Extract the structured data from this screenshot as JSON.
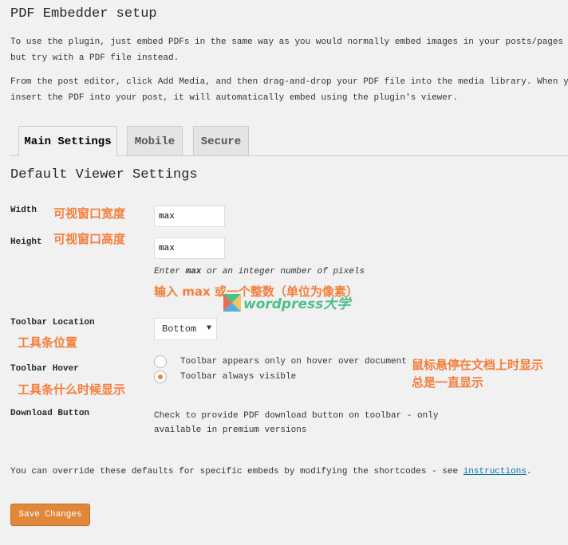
{
  "title": "PDF Embedder setup",
  "intro1a": "To use the plugin, just embed PDFs in the same way as you would normally embed images in your posts/pages -",
  "intro1b": "but try with a PDF file instead.",
  "intro2a": "From the post editor, click Add Media, and then drag-and-drop your PDF file into the media library. When you",
  "intro2b": "insert the PDF into your post, it will automatically embed using the plugin's viewer.",
  "tabs": [
    {
      "label": "Main Settings",
      "active": true
    },
    {
      "label": "Mobile"
    },
    {
      "label": "Secure"
    }
  ],
  "section_title": "Default Viewer Settings",
  "width": {
    "label": "Width",
    "note": "可视窗口宽度",
    "value": "max"
  },
  "height": {
    "label": "Height",
    "note": "可视窗口高度",
    "value": "max"
  },
  "hint_pre": "Enter ",
  "hint_bold": "max",
  "hint_post": " or an integer number of pixels",
  "hint_cn": "输入 max 或一个整数（单位为像素）",
  "watermark": "wordpress大学",
  "toolbar_location": {
    "label": "Toolbar Location",
    "note": "工具条位置",
    "value": "Bottom"
  },
  "toolbar_hover": {
    "label": "Toolbar Hover",
    "note": "工具条什么时候显示",
    "options": [
      "Toolbar appears only on hover over document",
      "Toolbar always visible"
    ],
    "selected": 1,
    "notes": [
      "鼠标悬停在文档上时显示",
      "总是一直显示"
    ]
  },
  "download": {
    "label": "Download Button",
    "text1": "Check to provide PDF download button on toolbar - only",
    "text2": "available in premium versions"
  },
  "footer_pre": "You can override these defaults for specific embeds by modifying the shortcodes - see ",
  "footer_link": "instructions",
  "footer_post": ".",
  "save": "Save Changes",
  "accent": "#e1873a"
}
